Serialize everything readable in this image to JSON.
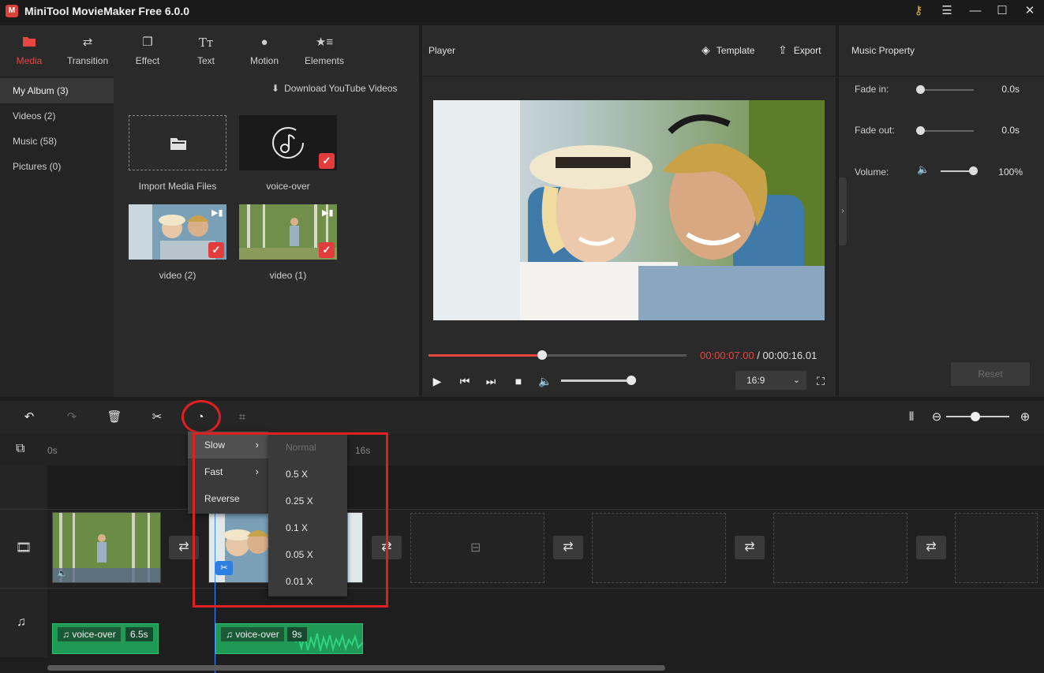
{
  "window": {
    "title": "MiniTool MovieMaker Free 6.0.0",
    "logo_glyph": "M"
  },
  "media_tabs": [
    {
      "label": "Media",
      "icon": "folder-icon",
      "active": true
    },
    {
      "label": "Transition",
      "icon": "transition-icon",
      "active": false
    },
    {
      "label": "Effect",
      "icon": "effect-icon",
      "active": false
    },
    {
      "label": "Text",
      "icon": "text-icon",
      "active": false
    },
    {
      "label": "Motion",
      "icon": "motion-icon",
      "active": false
    },
    {
      "label": "Elements",
      "icon": "elements-icon",
      "active": false
    }
  ],
  "sidebar": {
    "items": [
      {
        "label": "My Album (3)",
        "active": true
      },
      {
        "label": "Videos (2)",
        "active": false
      },
      {
        "label": "Music (58)",
        "active": false
      },
      {
        "label": "Pictures (0)",
        "active": false
      }
    ]
  },
  "media": {
    "download_label": "Download YouTube Videos",
    "tiles": [
      {
        "caption": "Import Media Files",
        "checked": false
      },
      {
        "caption": "voice-over",
        "checked": true
      },
      {
        "caption": "video (2)",
        "checked": true
      },
      {
        "caption": "video (1)",
        "checked": true
      }
    ]
  },
  "player": {
    "title": "Player",
    "template_label": "Template",
    "export_label": "Export",
    "current_time": "00:00:07.00",
    "separator": " / ",
    "total_time": "00:00:16.01",
    "progress": 0.44,
    "volume": 0.94,
    "aspect_ratio": "16:9"
  },
  "music_property": {
    "title": "Music Property",
    "fade_in_label": "Fade in:",
    "fade_in_value": "0.0s",
    "fade_out_label": "Fade out:",
    "fade_out_value": "0.0s",
    "volume_label": "Volume:",
    "volume_value": "100%",
    "reset_label": "Reset"
  },
  "timeline": {
    "ruler_start": "0s",
    "ruler_end": "16s",
    "audio_clips": [
      {
        "label": "voice-over",
        "duration": "6.5s"
      },
      {
        "label": "voice-over",
        "duration": "9s"
      }
    ]
  },
  "speed_menu": {
    "items": [
      {
        "label": "Slow",
        "active": true,
        "has_submenu": true
      },
      {
        "label": "Fast",
        "active": false,
        "has_submenu": true
      },
      {
        "label": "Reverse",
        "active": false,
        "has_submenu": false
      }
    ],
    "slow_options": [
      {
        "label": "Normal",
        "disabled": true
      },
      {
        "label": "0.5 X",
        "disabled": false
      },
      {
        "label": "0.25 X",
        "disabled": false
      },
      {
        "label": "0.1 X",
        "disabled": false
      },
      {
        "label": "0.05 X",
        "disabled": false
      },
      {
        "label": "0.01 X",
        "disabled": false
      }
    ]
  },
  "colors": {
    "accent": "#e8463e",
    "audio_clip": "#1f9a55",
    "highlight": "#e02020"
  }
}
